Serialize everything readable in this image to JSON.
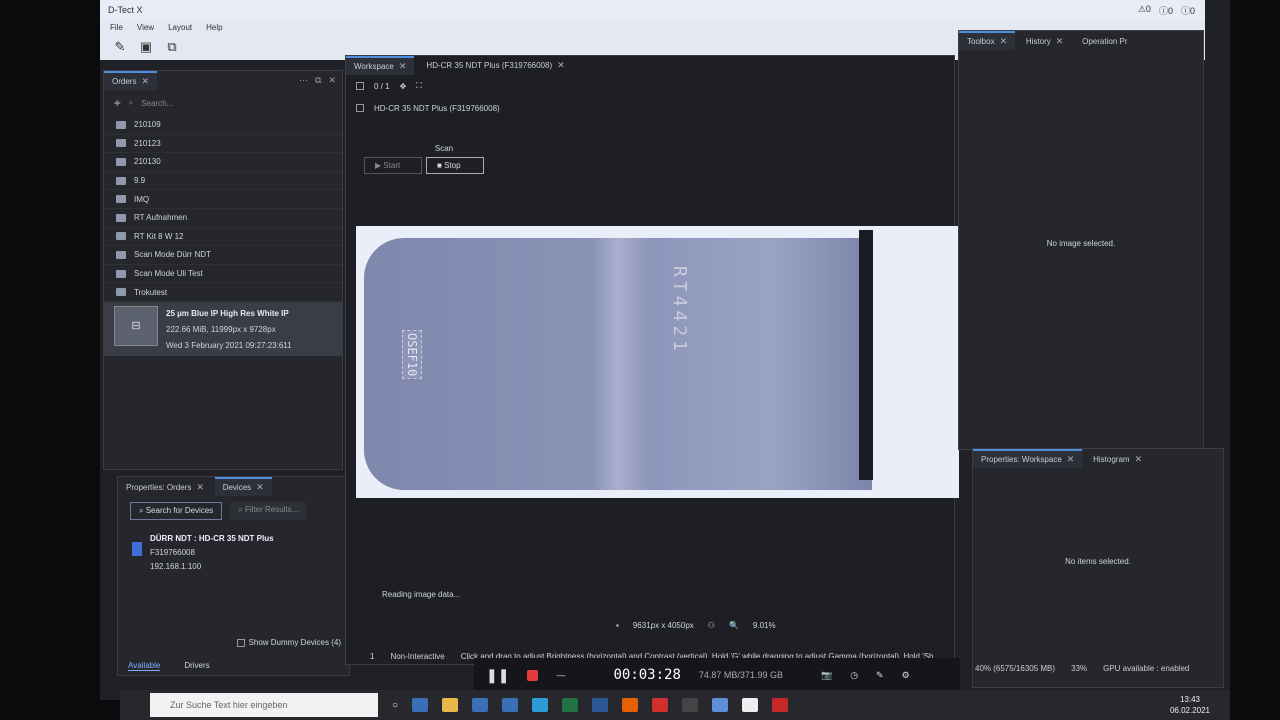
{
  "app": {
    "title": "D-Tect X",
    "warnings": [
      "0",
      "0",
      "0"
    ]
  },
  "menu": [
    "File",
    "View",
    "Layout",
    "Help"
  ],
  "orders": {
    "tab": "Orders",
    "search_placeholder": "Search...",
    "folders": [
      "210109",
      "210123",
      "210130",
      "9.9",
      "IMQ",
      "RT Aufnahmen",
      "RT Kit 8 W 12",
      "Scan Mode Dürr NDT",
      "Scan Mode Uli Test",
      "Trokutest"
    ],
    "selected": {
      "title": "25 µm Blue IP  High Res White IP",
      "size": "222.66 MiB, 11999px x 9728px",
      "date": "Wed 3 February 2021 09:27:23:611"
    }
  },
  "devices": {
    "tabs": [
      "Properties: Orders",
      "Devices"
    ],
    "search_button": "Search for Devices",
    "filter_placeholder": "Filter Results...",
    "device": {
      "name": "DÜRR NDT : HD-CR 35 NDT Plus",
      "serial": "F319766008",
      "ip": "192.168.1.100"
    },
    "show_dummy": "Show Dummy Devices (4)",
    "bottom_tabs": [
      "Available",
      "Drivers"
    ]
  },
  "workspace": {
    "tabs": [
      "Workspace",
      "HD-CR 35 NDT Plus (F319766008)"
    ],
    "counter": "0 / 1",
    "device_label": "HD-CR 35 NDT Plus (F319766008)",
    "scan_label": "Scan",
    "start": "Start",
    "stop": "Stop",
    "image_text_rt": "RT4421",
    "image_text_iqi": "OSEF10",
    "status": "Reading image data...",
    "dimensions": "9631px x 4050px",
    "zoom": "9.01%",
    "mode_index": "1",
    "mode": "Non-Interactive",
    "hint": "Click and drag to adjust Brightness (horizontal) and Contrast (vertical). Hold 'G' while dragging to adjust Gamma (horizontal). Hold 'Sh"
  },
  "right": {
    "tabs": [
      "Toolbox",
      "History",
      "Operation Pr"
    ],
    "no_image": "No image selected.",
    "props_tabs": [
      "Properties: Workspace",
      "Histogram"
    ],
    "no_items": "No items selected."
  },
  "recorder": {
    "time": "00:03:28",
    "storage": "74.87 MB/371.99 GB"
  },
  "system": {
    "mem": "40% (6575/16305 MB)",
    "cpu": "33%",
    "gpu": "GPU available : enabled"
  },
  "taskbar": {
    "search": "Zur Suche Text hier eingeben",
    "time": "13:43",
    "date": "06.02.2021"
  }
}
